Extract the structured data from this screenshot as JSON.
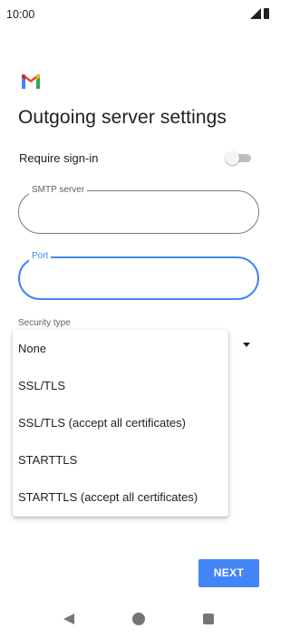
{
  "status_bar": {
    "time": "10:00",
    "icons": [
      "signal-icon",
      "battery-icon"
    ]
  },
  "header": {
    "logo": "gmail-logo-icon",
    "title": "Outgoing server settings"
  },
  "require_signin": {
    "label": "Require sign-in",
    "enabled": false
  },
  "smtp_server": {
    "label": "SMTP server",
    "value": ""
  },
  "port": {
    "label": "Port",
    "value": ""
  },
  "security": {
    "label": "Security type",
    "options": [
      "None",
      "SSL/TLS",
      "SSL/TLS (accept all certificates)",
      "STARTTLS",
      "STARTTLS (accept all certificates)"
    ]
  },
  "footer": {
    "next_label": "NEXT"
  },
  "nav_bar": {
    "icons": [
      "back-icon",
      "home-icon",
      "recents-icon"
    ]
  },
  "colors": {
    "accent": "#4285f4",
    "text": "#202124",
    "secondary_text": "#5f6368"
  }
}
